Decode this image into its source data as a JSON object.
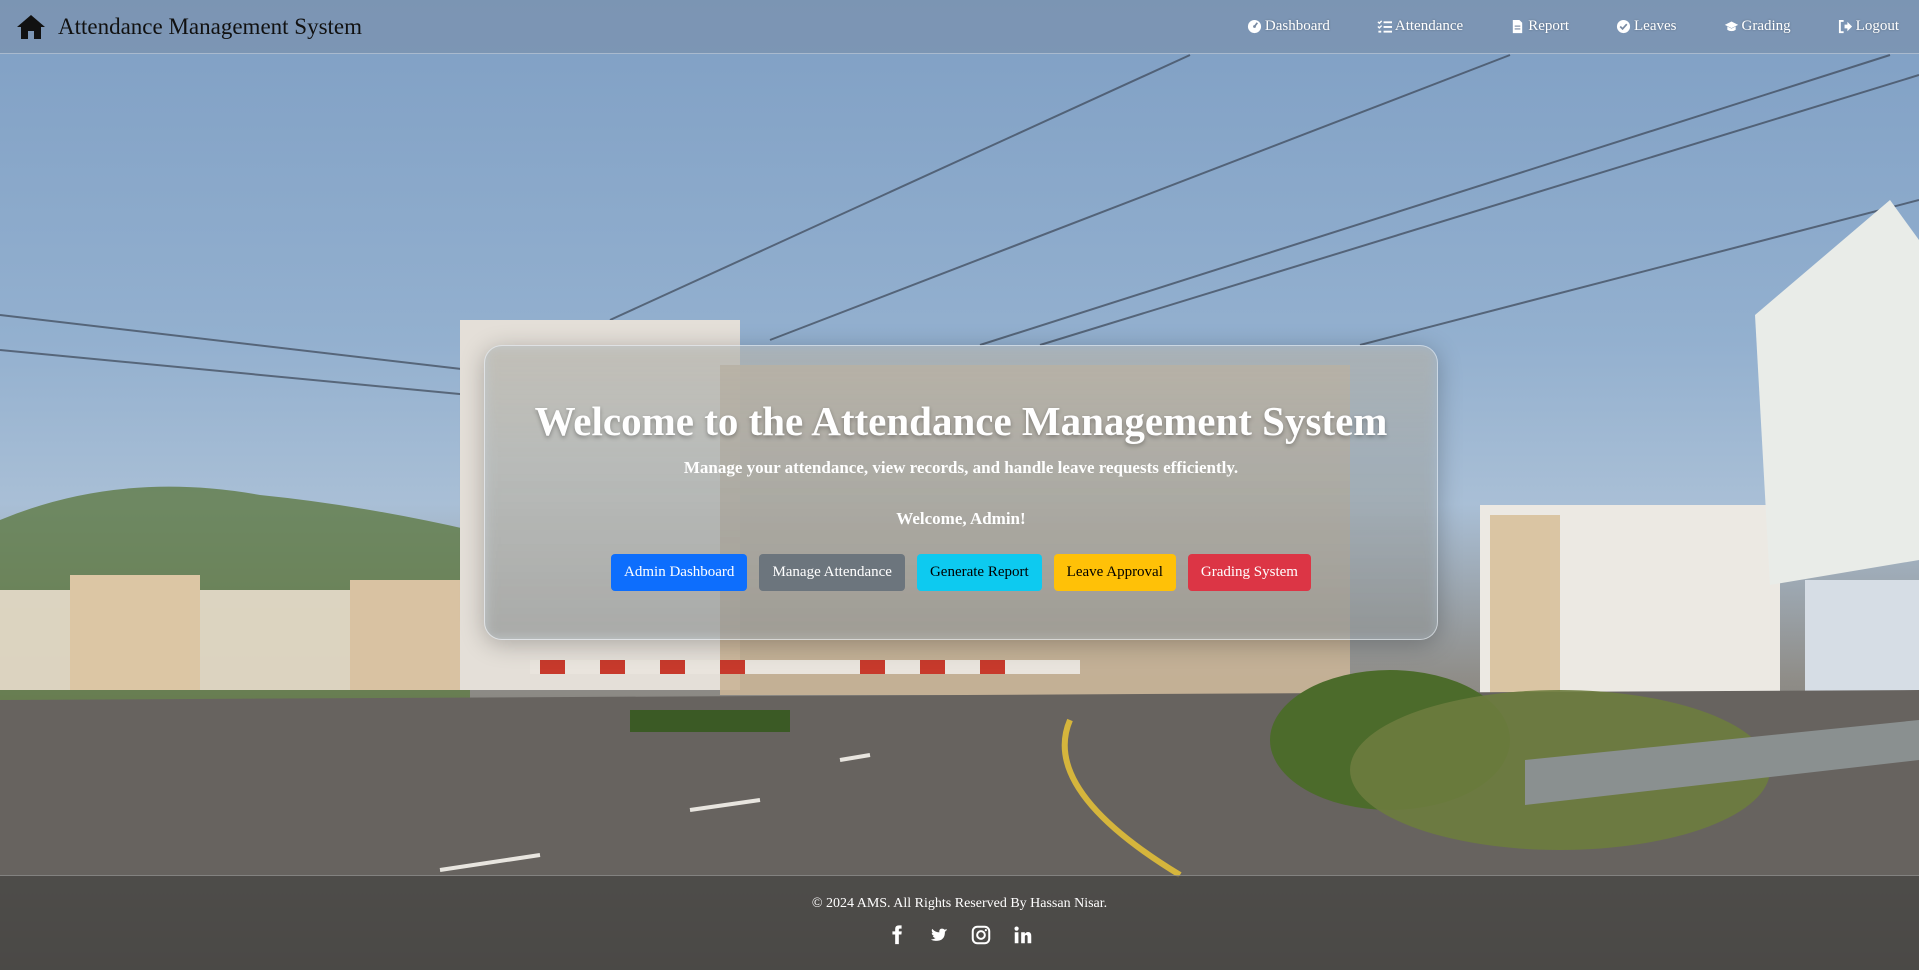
{
  "navbar": {
    "brand_title": "Attendance Management System",
    "links": [
      {
        "label": "Dashboard",
        "icon": "tachometer-icon"
      },
      {
        "label": "Attendance",
        "icon": "list-check-icon"
      },
      {
        "label": "Report",
        "icon": "file-icon"
      },
      {
        "label": "Leaves",
        "icon": "check-circle-icon"
      },
      {
        "label": "Grading",
        "icon": "graduation-cap-icon"
      },
      {
        "label": "Logout",
        "icon": "sign-out-icon"
      }
    ]
  },
  "hero": {
    "title": "Welcome to the Attendance Management System",
    "subtitle": "Manage your attendance, view records, and handle leave requests efficiently.",
    "welcome": "Welcome, Admin!",
    "buttons": [
      {
        "label": "Admin Dashboard",
        "color": "#0d6efd"
      },
      {
        "label": "Manage Attendance",
        "color": "#6c757d"
      },
      {
        "label": "Generate Report",
        "color": "#0dcaf0"
      },
      {
        "label": "Leave Approval",
        "color": "#ffc107"
      },
      {
        "label": "Grading System",
        "color": "#dc3545"
      }
    ]
  },
  "footer": {
    "copyright": "© 2024 AMS. All Rights Reserved By Hassan Nisar.",
    "socials": [
      "facebook-icon",
      "twitter-icon",
      "instagram-icon",
      "linkedin-icon"
    ]
  }
}
